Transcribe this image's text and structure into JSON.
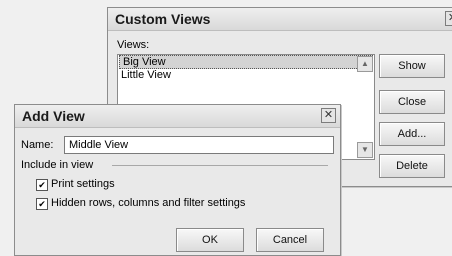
{
  "custom_views": {
    "title": "Custom Views",
    "views_label": "Views:",
    "views": [
      "Big View",
      "Little View"
    ],
    "selected_index": 0,
    "buttons": {
      "show": "Show",
      "close": "Close",
      "add": "Add...",
      "delete": "Delete"
    }
  },
  "add_view": {
    "title": "Add View",
    "name_label": "Name:",
    "name_value": "Middle View",
    "include_label": "Include in view",
    "checkboxes": [
      {
        "label": "Print settings",
        "checked": true
      },
      {
        "label": "Hidden rows, columns and filter settings",
        "checked": true
      }
    ],
    "ok": "OK",
    "cancel": "Cancel"
  },
  "icons": {
    "close": "close-icon",
    "scroll_up": "scroll-up-arrow",
    "scroll_down": "scroll-down-arrow",
    "checkmark": "checkmark"
  }
}
